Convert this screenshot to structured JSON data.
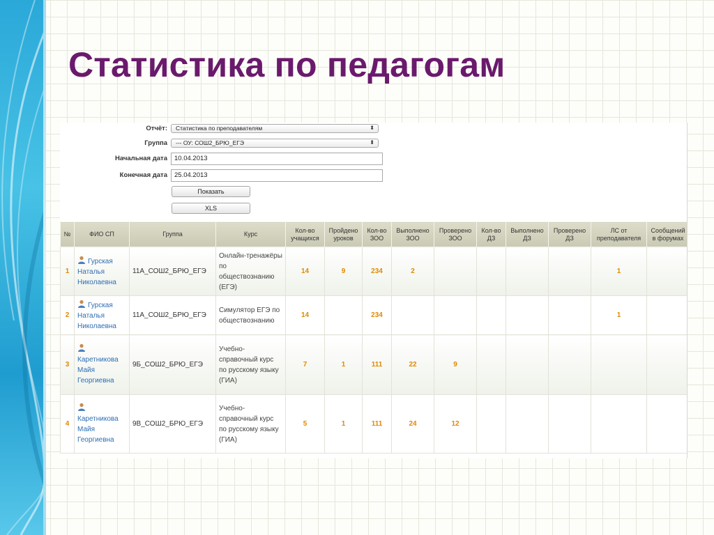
{
  "slide": {
    "title": "Статистика по педагогам"
  },
  "form": {
    "report_label": "Отчёт:",
    "report_value": "Статистика по преподавателям",
    "group_label": "Группа",
    "group_value": "--- ОУ: СОШ2_БРЮ_ЕГЭ",
    "start_label": "Начальная дата",
    "start_value": "10.04.2013",
    "end_label": "Конечная дата",
    "end_value": "25.04.2013",
    "show_button": "Показать",
    "xls_button": "XLS"
  },
  "table": {
    "headers": [
      "№",
      "ФИО СП",
      "Группа",
      "Курс",
      "Кол-во учащихся",
      "Пройдено уроков",
      "Кол-во ЗОО",
      "Выполнено ЗОО",
      "Проверено ЗОО",
      "Кол-во ДЗ",
      "Выполнено ДЗ",
      "Проверено ДЗ",
      "ЛС от преподавателя",
      "Сообщений в форумах"
    ],
    "rows": [
      {
        "idx": "1",
        "name": "Гурская Наталья Николаевна",
        "group": "11А_СОШ2_БРЮ_ЕГЭ",
        "course": "Онлайн-тренажёры по обществознанию (ЕГЭ)",
        "students": "14",
        "lessons": "9",
        "zoo_count": "234",
        "zoo_done": "2",
        "zoo_checked": "",
        "dz_count": "",
        "dz_done": "",
        "dz_checked": "",
        "ls": "1",
        "forum": ""
      },
      {
        "idx": "2",
        "name": "Гурская Наталья Николаевна",
        "group": "11А_СОШ2_БРЮ_ЕГЭ",
        "course": "Симулятор ЕГЭ по обществознанию",
        "students": "14",
        "lessons": "",
        "zoo_count": "234",
        "zoo_done": "",
        "zoo_checked": "",
        "dz_count": "",
        "dz_done": "",
        "dz_checked": "",
        "ls": "1",
        "forum": ""
      },
      {
        "idx": "3",
        "name": "Каретникова Майя Георгиевна",
        "group": "9Б_СОШ2_БРЮ_ЕГЭ",
        "course": "Учебно-справочный курс по русскому языку (ГИА)",
        "students": "7",
        "lessons": "1",
        "zoo_count": "111",
        "zoo_done": "22",
        "zoo_checked": "9",
        "dz_count": "",
        "dz_done": "",
        "dz_checked": "",
        "ls": "",
        "forum": ""
      },
      {
        "idx": "4",
        "name": "Каретникова Майя Георгиевна",
        "group": "9В_СОШ2_БРЮ_ЕГЭ",
        "course": "Учебно-справочный курс по русскому языку (ГИА)",
        "students": "5",
        "lessons": "1",
        "zoo_count": "111",
        "zoo_done": "24",
        "zoo_checked": "12",
        "dz_count": "",
        "dz_done": "",
        "dz_checked": "",
        "ls": "",
        "forum": ""
      }
    ]
  },
  "colors": {
    "title": "#6a1a6c",
    "numbers": "#e08a00",
    "link": "#2d6eb5",
    "header_bg": "#d3d3be"
  }
}
